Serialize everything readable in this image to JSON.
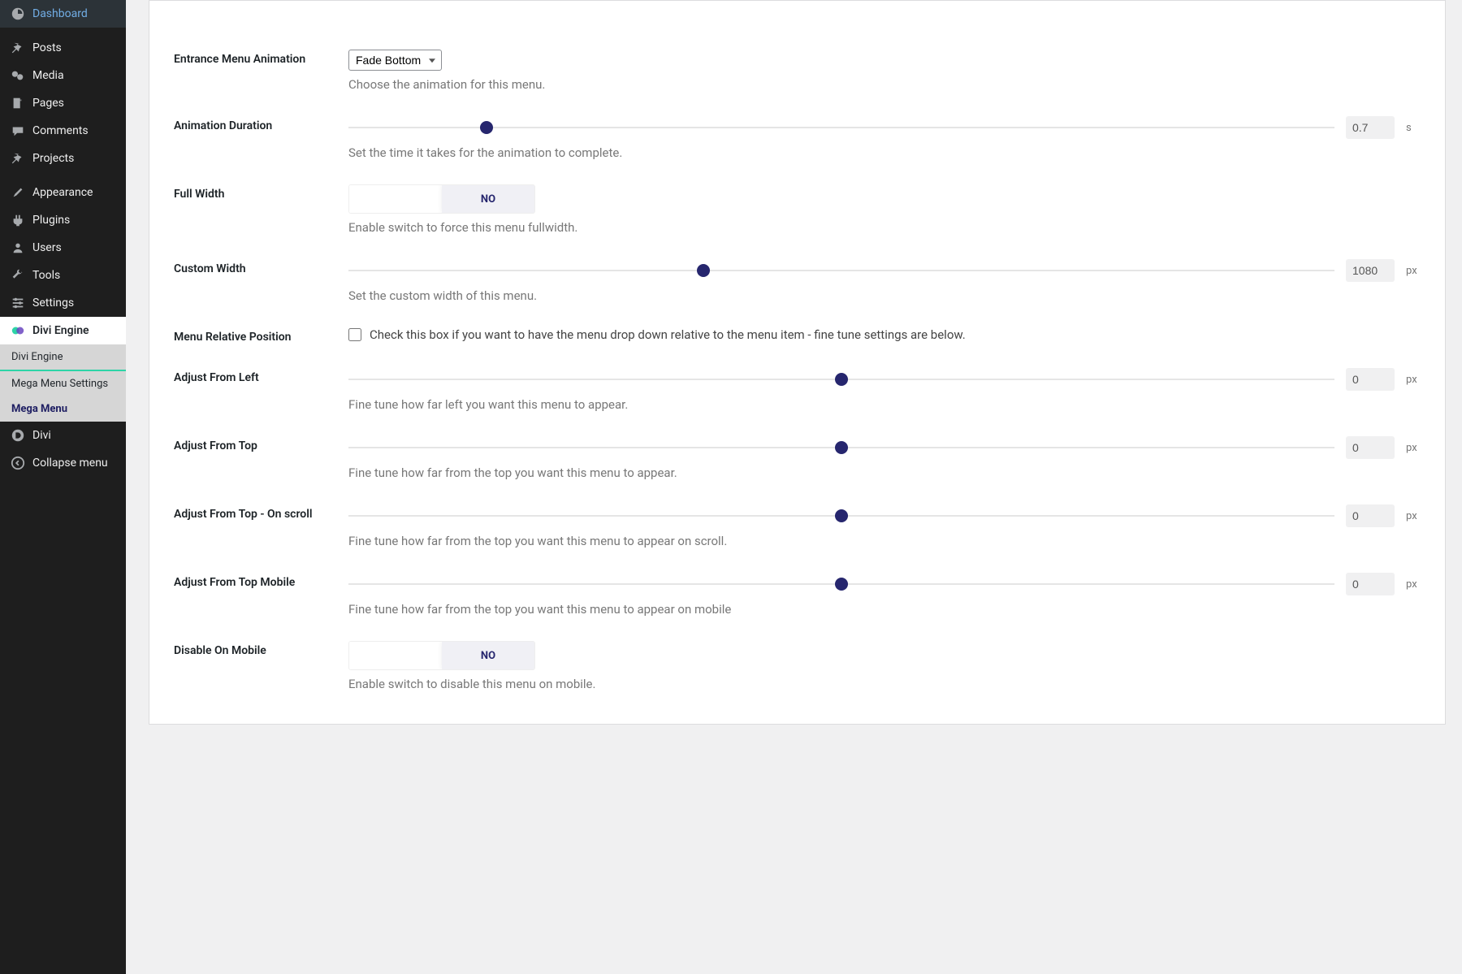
{
  "sidebar": {
    "items": [
      {
        "label": "Dashboard"
      },
      {
        "label": "Posts"
      },
      {
        "label": "Media"
      },
      {
        "label": "Pages"
      },
      {
        "label": "Comments"
      },
      {
        "label": "Projects"
      },
      {
        "label": "Appearance"
      },
      {
        "label": "Plugins"
      },
      {
        "label": "Users"
      },
      {
        "label": "Tools"
      },
      {
        "label": "Settings"
      },
      {
        "label": "Divi Engine"
      },
      {
        "label": "Divi"
      },
      {
        "label": "Collapse menu"
      }
    ],
    "submenu": [
      {
        "label": "Divi Engine"
      },
      {
        "label": "Mega Menu Settings"
      },
      {
        "label": "Mega Menu"
      }
    ]
  },
  "settings": {
    "entrance_animation": {
      "label": "Entrance Menu Animation",
      "value": "Fade Bottom",
      "desc": "Choose the animation for this menu."
    },
    "animation_duration": {
      "label": "Animation Duration",
      "value": "0.7",
      "unit": "s",
      "desc": "Set the time it takes for the animation to complete."
    },
    "full_width": {
      "label": "Full Width",
      "value": "NO",
      "desc": "Enable switch to force this menu fullwidth."
    },
    "custom_width": {
      "label": "Custom Width",
      "value": "1080",
      "unit": "px",
      "desc": "Set the custom width of this menu."
    },
    "menu_relative": {
      "label": "Menu Relative Position",
      "checkbox_label": "Check this box if you want to have the menu drop down relative to the menu item - fine tune settings are below."
    },
    "adjust_left": {
      "label": "Adjust From Left",
      "value": "0",
      "unit": "px",
      "desc": "Fine tune how far left you want this menu to appear."
    },
    "adjust_top": {
      "label": "Adjust From Top",
      "value": "0",
      "unit": "px",
      "desc": "Fine tune how far from the top you want this menu to appear."
    },
    "adjust_top_scroll": {
      "label": "Adjust From Top - On scroll",
      "value": "0",
      "unit": "px",
      "desc": "Fine tune how far from the top you want this menu to appear on scroll."
    },
    "adjust_top_mobile": {
      "label": "Adjust From Top Mobile",
      "value": "0",
      "unit": "px",
      "desc": "Fine tune how far from the top you want this menu to appear on mobile"
    },
    "disable_mobile": {
      "label": "Disable On Mobile",
      "value": "NO",
      "desc": "Enable switch to disable this menu on mobile."
    }
  }
}
